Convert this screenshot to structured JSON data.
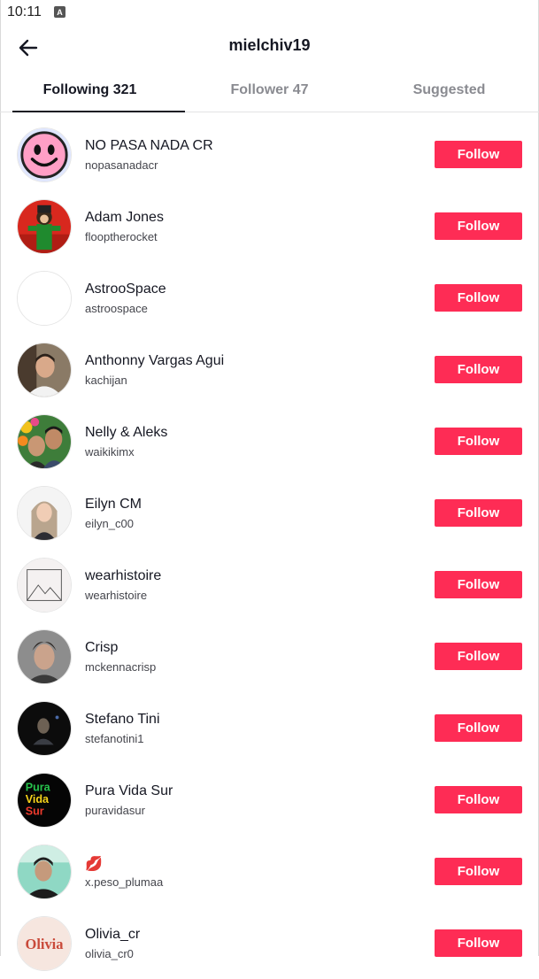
{
  "status_bar": {
    "time": "10:11",
    "notification_icon": "a-letter-icon"
  },
  "header": {
    "title": "mielchiv19",
    "back_icon": "arrow-left-icon"
  },
  "tabs": [
    {
      "label": "Following 321",
      "active": true
    },
    {
      "label": "Follower 47",
      "active": false
    },
    {
      "label": "Suggested",
      "active": false
    }
  ],
  "users": [
    {
      "name": "NO PASA NADA CR",
      "handle": "nopasanadacr",
      "button": "Follow",
      "avatar": "smiley-face-avatar"
    },
    {
      "name": "Adam Jones",
      "handle": "flooptherocket",
      "button": "Follow",
      "avatar": "costume-character-avatar"
    },
    {
      "name": "AstrooSpace",
      "handle": "astroospace",
      "button": "Follow",
      "avatar": "blank-avatar"
    },
    {
      "name": "Anthonny Vargas Agui",
      "handle": "kachijan",
      "button": "Follow",
      "avatar": "man-portrait-avatar"
    },
    {
      "name": "Nelly & Aleks",
      "handle": "waikikimx",
      "button": "Follow",
      "avatar": "couple-selfie-avatar"
    },
    {
      "name": "Eilyn CM",
      "handle": "eilyn_c00",
      "button": "Follow",
      "avatar": "woman-portrait-avatar"
    },
    {
      "name": "wearhistoire",
      "handle": "wearhistoire",
      "button": "Follow",
      "avatar": "mountain-logo-avatar"
    },
    {
      "name": "Crisp",
      "handle": "mckennacrisp",
      "button": "Follow",
      "avatar": "young-man-avatar"
    },
    {
      "name": "Stefano Tini",
      "handle": "stefanotini1",
      "button": "Follow",
      "avatar": "dark-stage-avatar"
    },
    {
      "name": "Pura Vida Sur",
      "handle": "puravidasur",
      "button": "Follow",
      "avatar": "pura-vida-sur-logo-avatar",
      "avatar_text": [
        "Pura",
        "Vida",
        "Sur"
      ]
    },
    {
      "name": "💋",
      "handle": "x.peso_plumaa",
      "button": "Follow",
      "avatar": "singer-portrait-avatar"
    },
    {
      "name": "Olivia_cr",
      "handle": "olivia_cr0",
      "button": "Follow",
      "avatar": "olivia-logo-avatar",
      "avatar_text": [
        "Olivia"
      ]
    }
  ],
  "colors": {
    "accent": "#fe2c55",
    "text_primary": "#161823",
    "text_secondary": "#8a8b91"
  }
}
